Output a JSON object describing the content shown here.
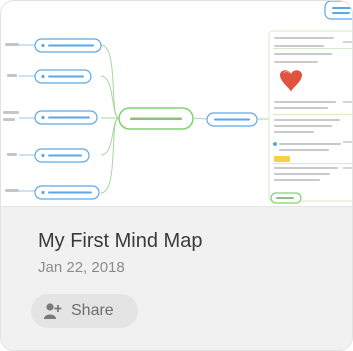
{
  "card": {
    "title": "My First Mind Map",
    "date": "Jan 22, 2018",
    "share_label": "Share"
  },
  "icons": {
    "share": "add-person-icon"
  },
  "colors": {
    "mindmap_center_border": "#7fd46b",
    "mindmap_branch": "#5aa9e6",
    "note_border": "#a8d96c",
    "heart": "#e0533f",
    "note_highlight": "#f5d33c"
  }
}
